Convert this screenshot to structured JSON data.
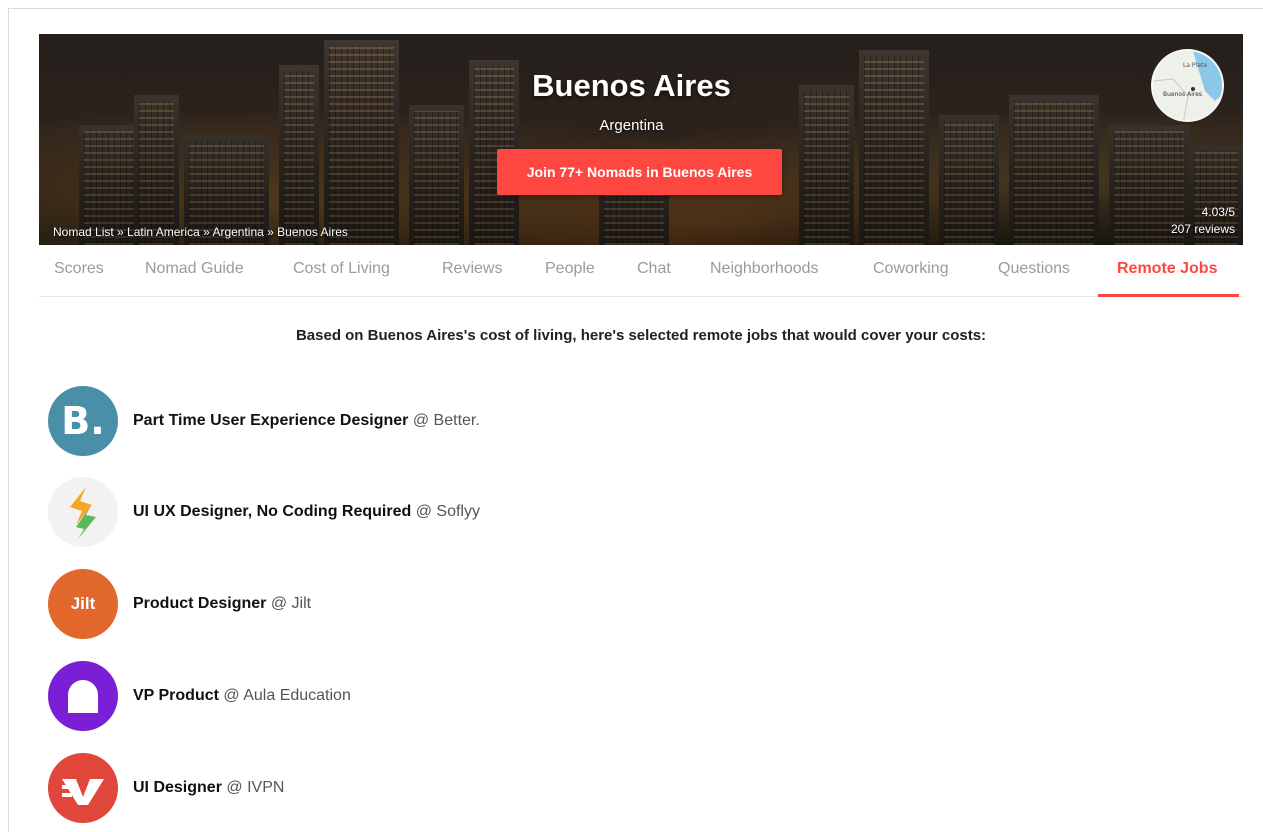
{
  "hero": {
    "city": "Buenos Aires",
    "country": "Argentina",
    "join_label": "Join 77+ Nomads in Buenos Aires",
    "breadcrumb": [
      "Nomad List",
      "Latin America",
      "Argentina",
      "Buenos Aires"
    ],
    "breadcrumb_sep": " » ",
    "rating": "4.03/5",
    "reviews": "207 reviews",
    "map_labels": [
      "La Plata",
      "Buenos Aires"
    ]
  },
  "tabs": [
    {
      "label": "Scores"
    },
    {
      "label": "Nomad Guide"
    },
    {
      "label": "Cost of Living"
    },
    {
      "label": "Reviews"
    },
    {
      "label": "People"
    },
    {
      "label": "Chat"
    },
    {
      "label": "Neighborhoods"
    },
    {
      "label": "Coworking"
    },
    {
      "label": "Questions"
    },
    {
      "label": "Remote Jobs",
      "active": true
    }
  ],
  "intro": "Based on Buenos Aires's cost of living, here's selected remote jobs that would cover your costs:",
  "jobs": [
    {
      "title": "Part Time User Experience Designer",
      "company": "Better.",
      "logo_text": "B.",
      "logo_color": "#4a8fa8",
      "logo_icon": "better-logo"
    },
    {
      "title": "UI UX Designer, No Coding Required",
      "company": "Soflyy",
      "logo_text": "",
      "logo_color": "#f2f2f2",
      "logo_icon": "soflyy-logo"
    },
    {
      "title": "Product Designer",
      "company": "Jilt",
      "logo_text": "Jilt",
      "logo_color": "#e2672a",
      "logo_icon": "jilt-logo"
    },
    {
      "title": "VP Product",
      "company": "Aula Education",
      "logo_text": "",
      "logo_color": "#7b1fd6",
      "logo_icon": "aula-logo"
    },
    {
      "title": "UI Designer",
      "company": "IVPN",
      "logo_text": "",
      "logo_color": "#e0463a",
      "logo_icon": "ivpn-logo"
    }
  ],
  "at_sign": "@",
  "colors": {
    "accent": "#ff4742",
    "tab_inactive": "#9a9a9a"
  }
}
